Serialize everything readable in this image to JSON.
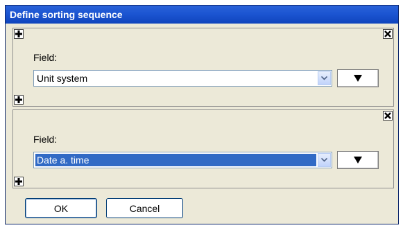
{
  "dialog": {
    "title": "Define sorting sequence",
    "ok_label": "OK",
    "cancel_label": "Cancel"
  },
  "groups": [
    {
      "field_label": "Field:",
      "field_value": "Unit system",
      "selected": false,
      "direction_icon": "sort-descending-triangle"
    },
    {
      "field_label": "Field:",
      "field_value": "Date a. time",
      "selected": true,
      "direction_icon": "sort-descending-triangle"
    }
  ],
  "icons": {
    "add": "plus-icon",
    "remove": "close-x-icon",
    "dropdown": "chevron-down-icon"
  },
  "colors": {
    "titlebar": "#1c55d2",
    "dialog_bg": "#ece9d8",
    "selection": "#316ac5"
  }
}
